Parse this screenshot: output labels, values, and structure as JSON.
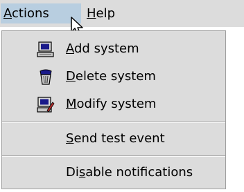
{
  "menubar": {
    "actions": {
      "pre": "",
      "mn": "A",
      "post": "ctions"
    },
    "help": {
      "pre": "",
      "mn": "H",
      "post": "elp"
    }
  },
  "menu": {
    "items": [
      {
        "pre": "",
        "mn": "A",
        "post": "dd system",
        "icon": "add-system-icon"
      },
      {
        "pre": "",
        "mn": "D",
        "post": "elete system",
        "icon": "delete-system-icon"
      },
      {
        "pre": "",
        "mn": "M",
        "post": "odify system",
        "icon": "modify-system-icon"
      },
      {
        "pre": "",
        "mn": "S",
        "post": "end test event"
      },
      {
        "pre": "Di",
        "mn": "s",
        "post": "able notifications"
      }
    ]
  },
  "colors": {
    "menu_bg": "#dcdcdc",
    "selected_title_bg": "#b8cee0"
  }
}
